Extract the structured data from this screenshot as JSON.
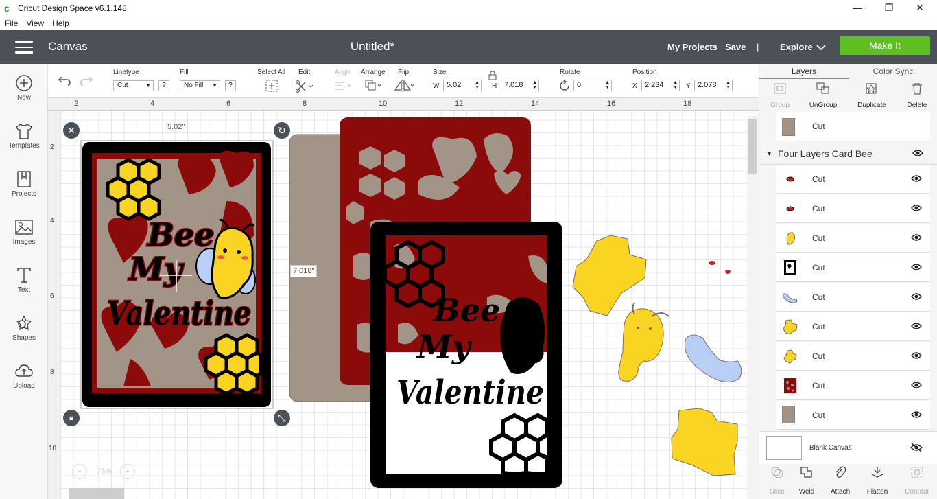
{
  "window": {
    "title": "Cricut Design Space   v6.1.148",
    "menu": [
      "File",
      "View",
      "Help"
    ],
    "minimize": "—",
    "maximize": "❐",
    "close": "✕"
  },
  "header": {
    "section": "Canvas",
    "doc_title": "Untitled*",
    "my_projects": "My Projects",
    "save": "Save",
    "separator": "|",
    "explore": "Explore",
    "make_it": "Make It"
  },
  "sidebar": {
    "items": [
      {
        "label": "New",
        "icon": "plus-circle-icon"
      },
      {
        "label": "Templates",
        "icon": "shirt-icon"
      },
      {
        "label": "Projects",
        "icon": "bookmark-icon"
      },
      {
        "label": "Images",
        "icon": "image-icon"
      },
      {
        "label": "Text",
        "icon": "text-icon"
      },
      {
        "label": "Shapes",
        "icon": "shapes-icon"
      },
      {
        "label": "Upload",
        "icon": "upload-cloud-icon"
      }
    ]
  },
  "toolbar": {
    "linetype_label": "Linetype",
    "linetype_value": "Cut",
    "fill_label": "Fill",
    "fill_value": "No Fill",
    "help": "?",
    "select_all": "Select All",
    "edit": "Edit",
    "align": "Align",
    "arrange": "Arrange",
    "flip": "Flip",
    "size_label": "Size",
    "w_label": "W",
    "w_value": "5.02",
    "h_label": "H",
    "h_value": "7.018",
    "rotate_label": "Rotate",
    "rotate_value": "0",
    "position_label": "Position",
    "x_label": "X",
    "x_value": "2.234",
    "y_label": "Y",
    "y_value": "2.078"
  },
  "rulers": {
    "top": [
      "2",
      "4",
      "6",
      "8",
      "10",
      "12",
      "14",
      "16",
      "18"
    ],
    "left": [
      "2",
      "4",
      "6",
      "8",
      "10"
    ]
  },
  "canvas": {
    "width_label": "5.02\"",
    "height_label": "7.018\"",
    "zoom": "75%",
    "zoom_minus": "−",
    "zoom_plus": "+",
    "card_text": [
      "Bee",
      "My",
      "Valentine"
    ],
    "colors": {
      "black": "#000000",
      "red": "#8b0a0a",
      "taupe": "#a39488",
      "yellow": "#f9d422",
      "light_blue": "#b8cef5"
    }
  },
  "panel": {
    "tabs": [
      "Layers",
      "Color Sync"
    ],
    "actions": [
      "Group",
      "UnGroup",
      "Duplicate",
      "Delete"
    ],
    "top_layer": {
      "name": "Cut",
      "color": "#a39488"
    },
    "group_name": "Four Layers Card Bee",
    "layers": [
      {
        "name": "Cut",
        "thumb": "red-dot"
      },
      {
        "name": "Cut",
        "thumb": "red-dot"
      },
      {
        "name": "Cut",
        "thumb": "bee"
      },
      {
        "name": "Cut",
        "thumb": "black-frame"
      },
      {
        "name": "Cut",
        "thumb": "blue-wing"
      },
      {
        "name": "Cut",
        "thumb": "yellow-hex"
      },
      {
        "name": "Cut",
        "thumb": "yellow-hex-small"
      },
      {
        "name": "Cut",
        "thumb": "red-lace"
      },
      {
        "name": "Cut",
        "thumb": "taupe-rect"
      }
    ],
    "blank_canvas": "Blank Canvas",
    "bottom_actions": [
      "Slice",
      "Weld",
      "Attach",
      "Flatten",
      "Contour"
    ]
  }
}
